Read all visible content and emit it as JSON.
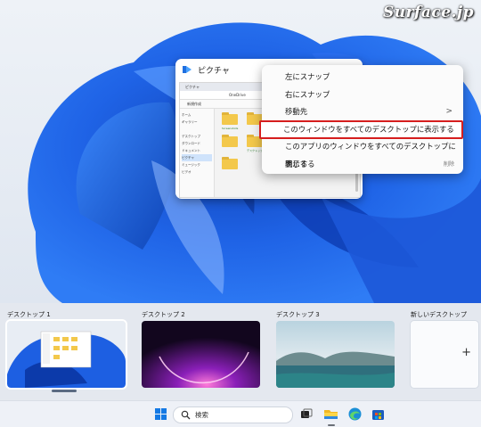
{
  "watermark": "Surface.jp",
  "window": {
    "title": "ピクチャ",
    "mini_tab": "ピクチャ",
    "mini_address": "OneDrive",
    "mini_command": "新規作成",
    "mini_sidebar": [
      "ホーム",
      "ギャラリー",
      "",
      "デスクトップ",
      "ダウンロード",
      "ドキュメント",
      "ピクチャ",
      "ミュージック",
      "ビデオ"
    ],
    "mini_folders": [
      "Screenshots",
      "",
      "",
      "デスクトップ",
      "",
      ""
    ]
  },
  "context_menu": {
    "items": [
      {
        "label": "左にスナップ"
      },
      {
        "label": "右にスナップ"
      },
      {
        "label": "移動先",
        "submenu": ">"
      },
      {
        "label": "このウィンドウをすべてのデスクトップに表示する",
        "highlighted": true
      },
      {
        "label": "このアプリのウィンドウをすべてのデスクトップに表示する"
      },
      {
        "label": "閉じる",
        "accelerator": "削除"
      }
    ],
    "highlight_color": "#d61e1e"
  },
  "desktops": [
    {
      "label": "デスクトップ 1",
      "active": true
    },
    {
      "label": "デスクトップ 2",
      "active": false
    },
    {
      "label": "デスクトップ 3",
      "active": false
    }
  ],
  "new_desktop": {
    "label": "新しいデスクトップ",
    "plus": "+"
  },
  "taskbar": {
    "search_placeholder": "検索",
    "icons": [
      "windows-start-icon",
      "search-icon",
      "task-view-icon",
      "file-explorer-icon",
      "edge-icon",
      "store-icon"
    ]
  },
  "colors": {
    "accent": "#0067c0",
    "wallpaper": "#1c5fe0"
  }
}
